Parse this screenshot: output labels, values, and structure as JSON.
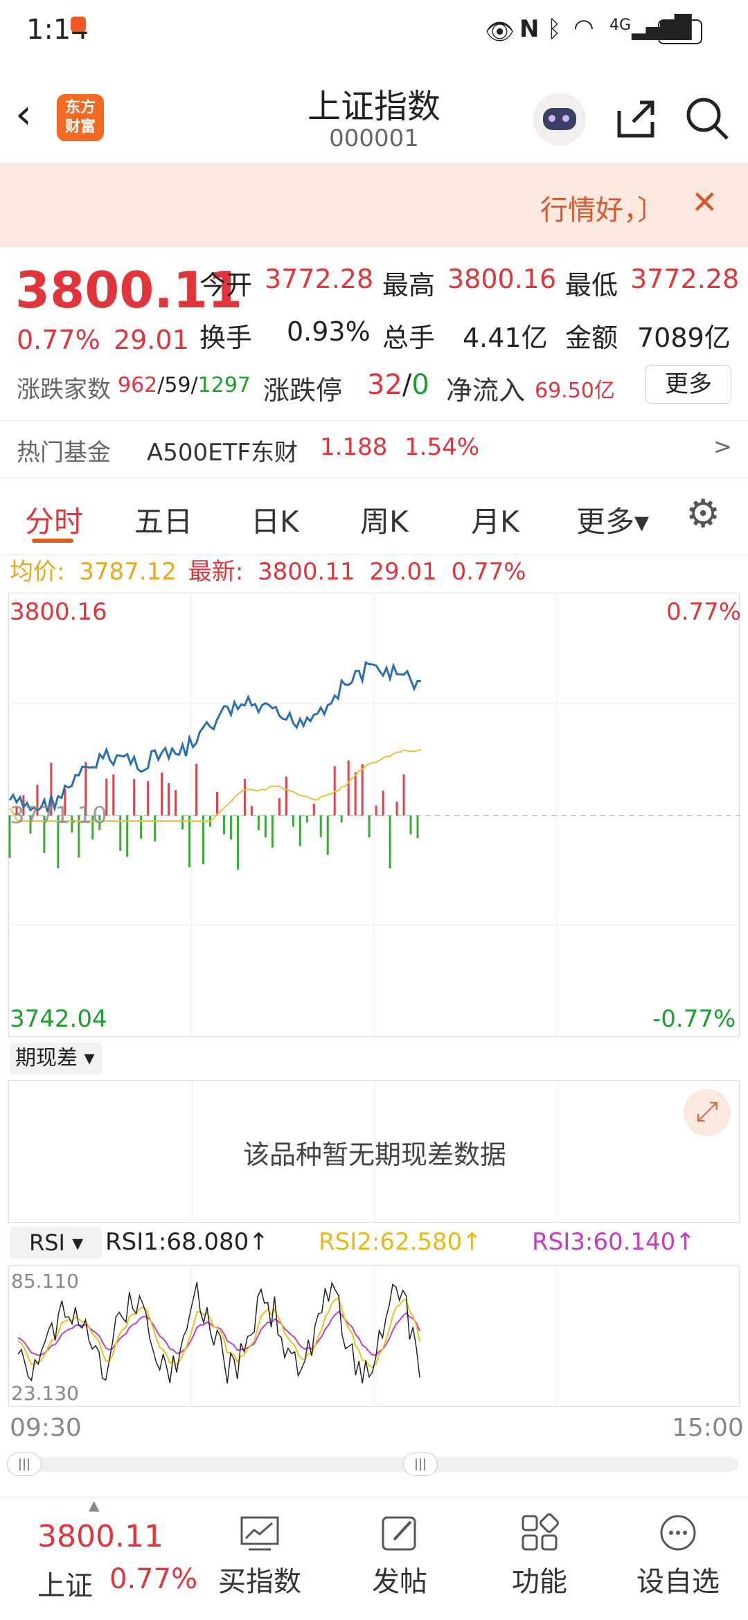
{
  "status": {
    "time": "1:14",
    "network": "4G",
    "battery": "91"
  },
  "header": {
    "title": "上证指数",
    "code": "000001",
    "logo_text_1": "东方",
    "logo_text_2": "财富"
  },
  "banner": {
    "text": "行情好，〕"
  },
  "quote": {
    "price": "3800.11",
    "change_pct": "0.77%",
    "change": "29.01",
    "open_label": "今开",
    "open": "3772.28",
    "high_label": "最高",
    "high": "3800.16",
    "low_label": "最低",
    "low": "3772.28",
    "turnover_label": "换手",
    "turnover": "0.93%",
    "volume_label": "总手",
    "volume": "4.41亿",
    "amount_label": "金额",
    "amount": "7089亿",
    "breadth_label": "涨跌家数",
    "breadth_up": "962",
    "breadth_flat": "/59/",
    "breadth_down": "1297",
    "limit_label": "涨跌停",
    "limit_up": "32",
    "limit_sep": "/",
    "limit_down": "0",
    "inflow_label": "净流入",
    "inflow": "69.50亿",
    "more_button": "更多"
  },
  "fund": {
    "label": "热门基金",
    "name": "A500ETF东财",
    "price": "1.188",
    "pct": "1.54%",
    "arrow": ">"
  },
  "tabs": [
    "分时",
    "五日",
    "日K",
    "周K",
    "月K",
    "更多▾"
  ],
  "avg_bar": {
    "avg_label": "均价:",
    "avg": "3787.12",
    "latest_label": "最新:",
    "latest": "3800.11",
    "change": "29.01",
    "pct": "0.77%"
  },
  "chart": {
    "y_high": "3800.16",
    "y_low": "3742.04",
    "y_mid": "3771.10",
    "pct_high": "0.77%",
    "pct_low": "-0.77%",
    "colors": {
      "price": "#2a6fb0",
      "avg": "#e9bf3b",
      "up": "#d9454a",
      "down": "#3ea63a"
    }
  },
  "basis": {
    "selector": "期现差 ▾",
    "empty_text": "该品种暂无期现差数据"
  },
  "rsi": {
    "selector": "RSI ▾",
    "rsi1": "RSI1:68.080↑",
    "rsi2": "RSI2:62.580↑",
    "rsi3": "RSI3:60.140↑",
    "top": "85.110",
    "bottom": "23.130",
    "colors": {
      "rsi1": "#222222",
      "rsi2": "#e7c21c",
      "rsi3": "#c43bc4"
    }
  },
  "time_axis": {
    "start": "09:30",
    "end": "15:00"
  },
  "bottom_nav": {
    "index_price": "3800.11",
    "index_name": "上证",
    "index_pct": "0.77%",
    "items": [
      "买指数",
      "发帖",
      "功能",
      "设自选"
    ]
  }
}
